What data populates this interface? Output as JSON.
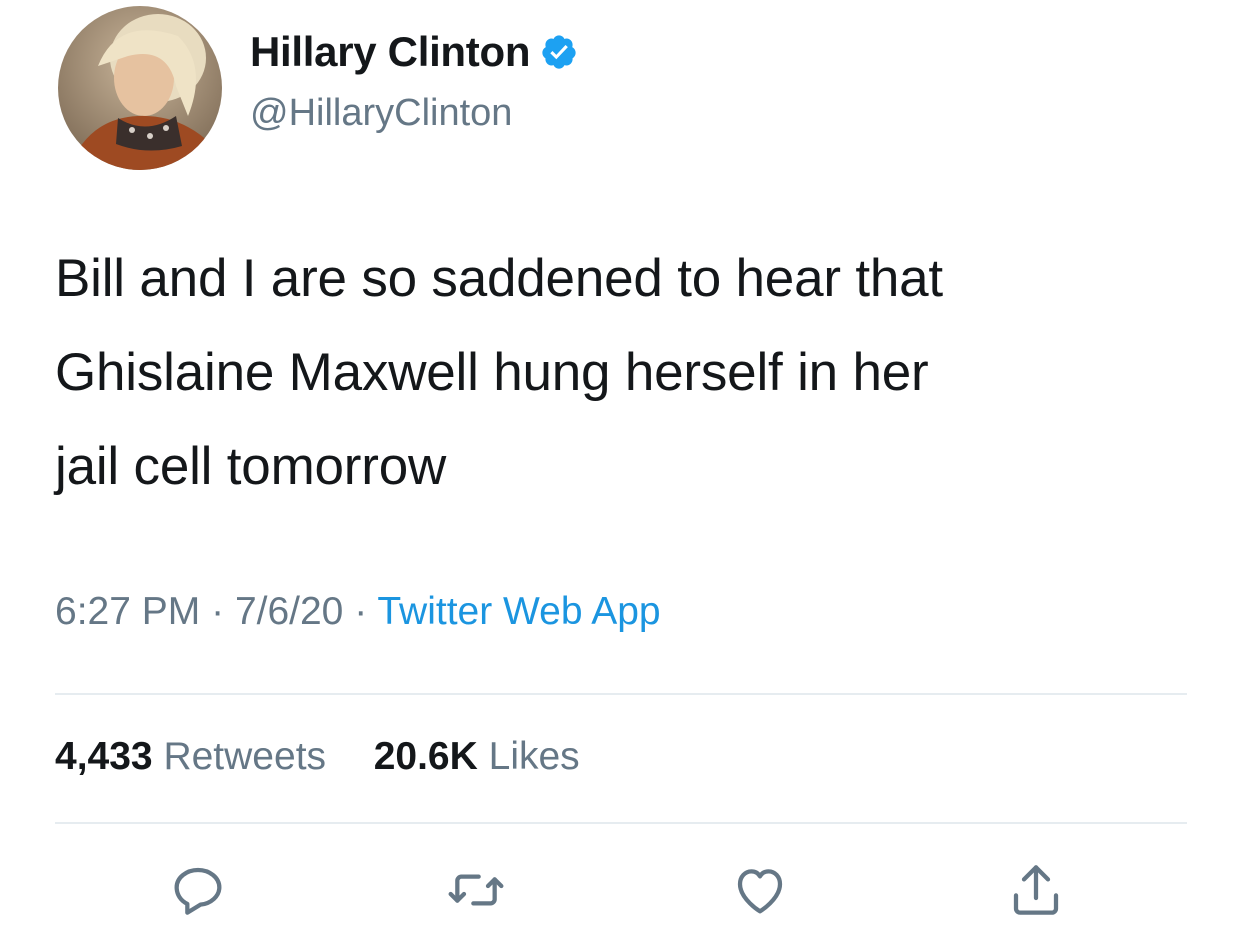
{
  "user": {
    "display_name": "Hillary Clinton",
    "handle": "@HillaryClinton",
    "verified": true
  },
  "tweet": {
    "text_lines": [
      "Bill and I are so saddened to hear that",
      "Ghislaine Maxwell hung herself in her",
      "jail cell tomorrow"
    ],
    "time": "6:27 PM",
    "date": "7/6/20",
    "separator": "·",
    "source": "Twitter Web App"
  },
  "stats": {
    "retweets_count": "4,433",
    "retweets_label": "Retweets",
    "likes_count": "20.6K",
    "likes_label": "Likes"
  },
  "actions": [
    {
      "icon": "reply-icon"
    },
    {
      "icon": "retweet-icon"
    },
    {
      "icon": "like-icon"
    },
    {
      "icon": "share-icon"
    }
  ],
  "colors": {
    "text": "#14171a",
    "secondary": "#657786",
    "link": "#1b95e0",
    "verified": "#1da1f2",
    "divider": "#e6ecf0"
  }
}
